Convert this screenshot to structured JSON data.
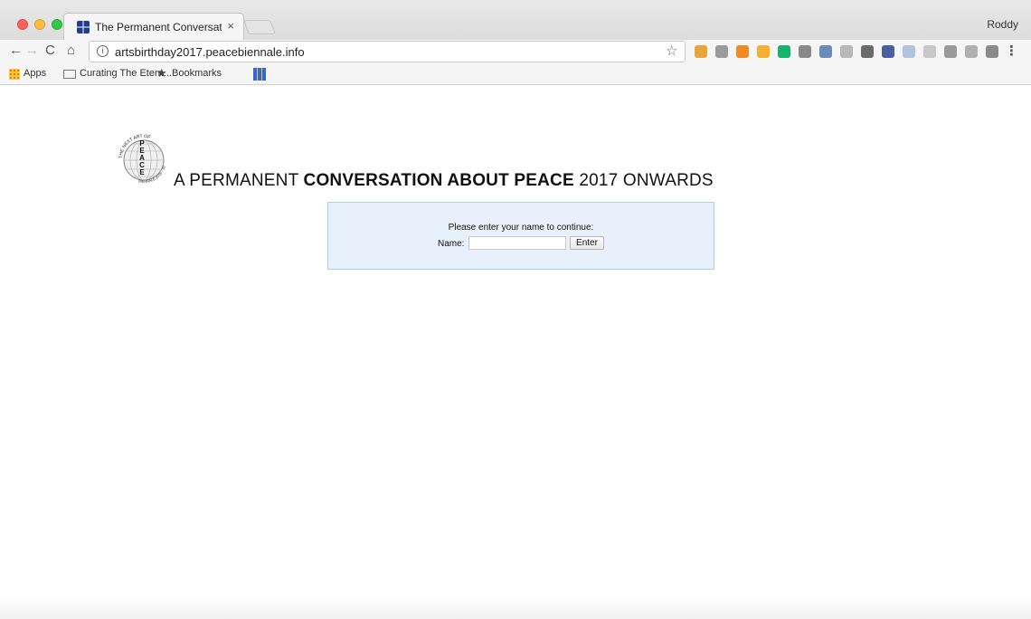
{
  "browser": {
    "tab_title": "The Permanent Conversation A",
    "tab_close": "×",
    "profile_name": "Roddy",
    "url": "artsbirthday2017.peacebiennale.info",
    "nav": {
      "back": "←",
      "forward": "→",
      "reload": "C",
      "home": "⌂",
      "bookmark_star": "☆",
      "menu": "⋮"
    },
    "extensions": [
      {
        "icon": "flag-icon",
        "color": "#e8a33a"
      },
      {
        "icon": "camera-icon",
        "color": "#9a9a9a"
      },
      {
        "icon": "chart-icon",
        "color": "#f08a24"
      },
      {
        "icon": "shield-icon",
        "color": "#f5b030"
      },
      {
        "icon": "grammarly-icon",
        "color": "#15b36b"
      },
      {
        "icon": "eye-icon",
        "color": "#8a8a8a"
      },
      {
        "icon": "download-icon",
        "color": "#6a8ab8"
      },
      {
        "icon": "save-icon",
        "color": "#b8b8b8"
      },
      {
        "icon": "crop-icon",
        "color": "#6a6a6a"
      },
      {
        "icon": "book-icon",
        "color": "#4a5f9e"
      },
      {
        "icon": "feather-icon",
        "color": "#b0c4e0"
      },
      {
        "icon": "image-icon",
        "color": "#c8c8c8"
      },
      {
        "icon": "globe-icon",
        "color": "#9a9a9a"
      },
      {
        "icon": "clipboard-icon",
        "color": "#b0b0b0"
      },
      {
        "icon": "person-icon",
        "color": "#8a8a8a"
      }
    ]
  },
  "bookmarks": {
    "apps": "Apps",
    "folder": "Curating The Etern...",
    "bookmarks": "Bookmarks"
  },
  "page": {
    "logo_text": {
      "top": "THE NEXT ART OF:",
      "letters": [
        "P",
        "E",
        "A",
        "C",
        "E"
      ],
      "bottom": "BIENNALE 2016 - 2017"
    },
    "headline": {
      "part1": "A PERMANENT ",
      "bold": "CONVERSATION ABOUT PEACE",
      "part2": " 2017 ONWARDS"
    },
    "login": {
      "prompt": "Please enter your name to continue:",
      "name_label": "Name:",
      "name_value": "",
      "enter_label": "Enter"
    }
  }
}
